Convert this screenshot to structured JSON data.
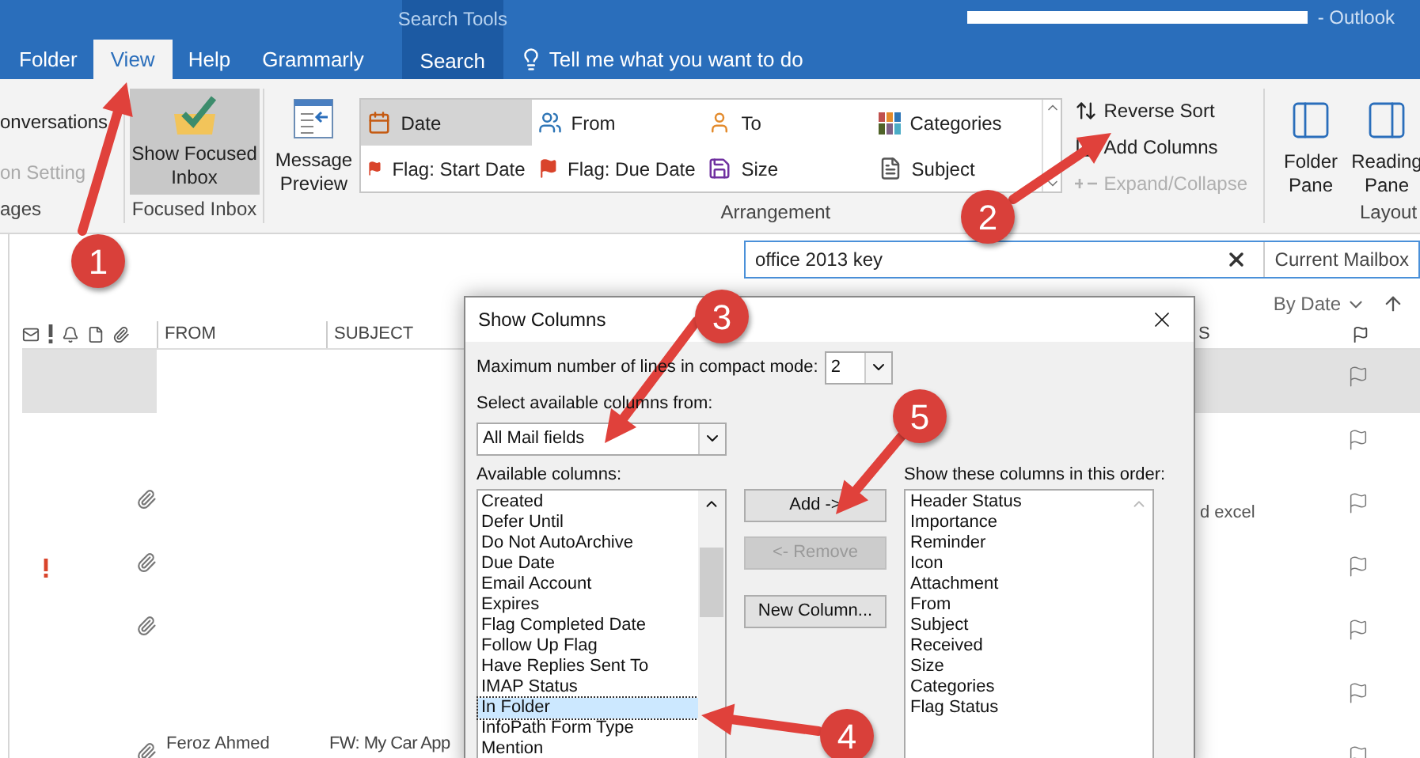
{
  "title_bar": {
    "context_label": "Search Tools",
    "title": "- Outlook"
  },
  "tabs": [
    {
      "label": "Folder",
      "selected": false,
      "kind": "tab"
    },
    {
      "label": "View",
      "selected": true,
      "kind": "tab"
    },
    {
      "label": "Help",
      "selected": false,
      "kind": "tab"
    },
    {
      "label": "Grammarly",
      "selected": false,
      "kind": "tab"
    },
    {
      "label": "Search",
      "selected": false,
      "kind": "contextual"
    }
  ],
  "tell_me": "Tell me what you want to do",
  "ribbon": {
    "cut_group": {
      "items": [
        {
          "label": "onversations",
          "disabled": false
        },
        {
          "label": "on Setting",
          "disabled": true
        }
      ],
      "label": "ages"
    },
    "focused_inbox": {
      "button": "Show Focused Inbox",
      "selected": true,
      "label": "Focused Inbox"
    },
    "message_preview": "Message Preview",
    "arrangement": {
      "items": [
        {
          "label": "Date",
          "selected": true
        },
        {
          "label": "From",
          "selected": false
        },
        {
          "label": "To",
          "selected": false
        },
        {
          "label": "Categories",
          "selected": false
        },
        {
          "label": "Flag: Start Date",
          "selected": false
        },
        {
          "label": "Flag: Due Date",
          "selected": false
        },
        {
          "label": "Size",
          "selected": false
        },
        {
          "label": "Subject",
          "selected": false
        }
      ],
      "label": "Arrangement"
    },
    "sort_commands": [
      {
        "label": "Reverse Sort",
        "disabled": false
      },
      {
        "label": "Add Columns",
        "disabled": false
      },
      {
        "label": "Expand/Collapse",
        "disabled": true
      }
    ],
    "layout": {
      "buttons": [
        "Folder Pane",
        "Reading Pane"
      ],
      "label": "Layout"
    }
  },
  "search": {
    "value": "office 2013 key",
    "scope": "Current Mailbox"
  },
  "sort": {
    "label": "By Date"
  },
  "columns": {
    "from": "FROM",
    "subject": "SUBJECT",
    "column_3": "S"
  },
  "rows": [
    {
      "selected": true,
      "redacted": true,
      "important": false,
      "attachment": false
    },
    {
      "selected": false,
      "redacted": false,
      "important": false,
      "attachment": false
    },
    {
      "selected": false,
      "redacted": false,
      "important": false,
      "attachment": true,
      "preview": "d excel"
    },
    {
      "selected": false,
      "redacted": false,
      "important": true,
      "attachment": true
    },
    {
      "selected": false,
      "redacted": false,
      "important": false,
      "attachment": true
    },
    {
      "selected": false,
      "redacted": false,
      "important": false,
      "attachment": false
    },
    {
      "selected": false,
      "redacted": false,
      "important": false,
      "attachment": true,
      "from": "Feroz Ahmed",
      "subject": "FW: My Car App"
    }
  ],
  "dialog": {
    "title": "Show Columns",
    "max_lines_label": "Maximum number of lines in compact mode:",
    "max_lines": "2",
    "source_label": "Select available columns from:",
    "source": "All Mail fields",
    "available_label": "Available columns:",
    "available": [
      {
        "label": "Created",
        "selected": false
      },
      {
        "label": "Defer Until",
        "selected": false
      },
      {
        "label": "Do Not AutoArchive",
        "selected": false
      },
      {
        "label": "Due Date",
        "selected": false
      },
      {
        "label": "Email Account",
        "selected": false
      },
      {
        "label": "Expires",
        "selected": false
      },
      {
        "label": "Flag Completed Date",
        "selected": false
      },
      {
        "label": "Follow Up Flag",
        "selected": false
      },
      {
        "label": "Have Replies Sent To",
        "selected": false
      },
      {
        "label": "IMAP Status",
        "selected": false
      },
      {
        "label": "In Folder",
        "selected": true
      },
      {
        "label": "InfoPath Form Type",
        "selected": false
      },
      {
        "label": "Mention",
        "selected": false
      }
    ],
    "buttons": [
      {
        "label": "Add ->",
        "disabled": false
      },
      {
        "label": "<- Remove",
        "disabled": true
      },
      {
        "label": "New Column...",
        "disabled": false
      }
    ],
    "shown_label": "Show these columns in this order:",
    "shown": [
      "Header Status",
      "Importance",
      "Reminder",
      "Icon",
      "Attachment",
      "From",
      "Subject",
      "Received",
      "Size",
      "Categories",
      "Flag Status"
    ]
  },
  "annotations": [
    "1",
    "2",
    "3",
    "4",
    "5"
  ]
}
